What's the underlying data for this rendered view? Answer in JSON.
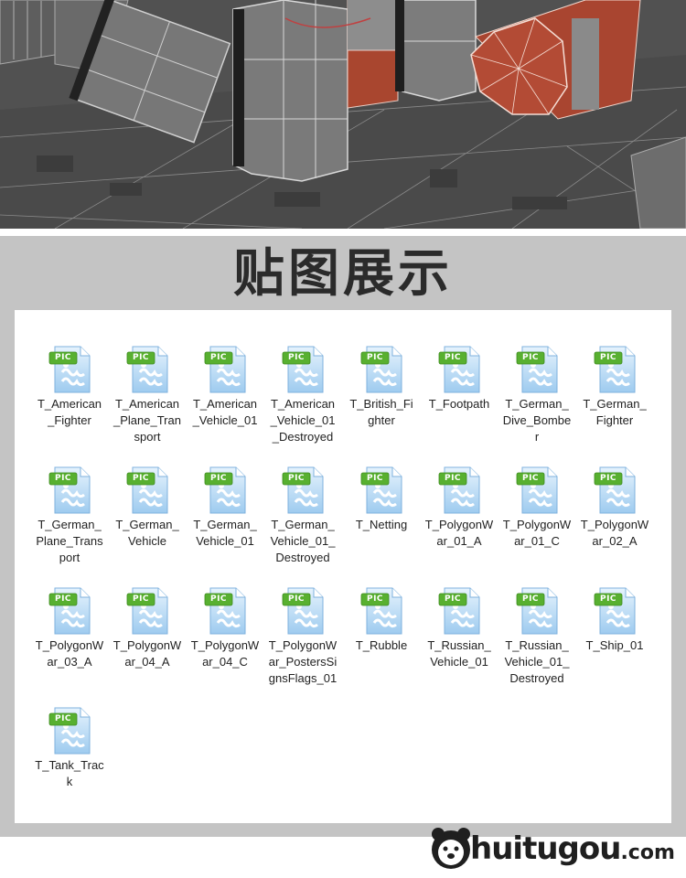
{
  "section_title": "贴图展示",
  "badge": "PIC",
  "files": [
    "T_American_Fighter",
    "T_American_Plane_Transport",
    "T_American_Vehicle_01",
    "T_American_Vehicle_01_Destroyed",
    "T_British_Fighter",
    "T_Footpath",
    "T_German_Dive_Bomber",
    "T_German_Fighter",
    "T_German_Plane_Transport",
    "T_German_Vehicle",
    "T_German_Vehicle_01",
    "T_German_Vehicle_01_Destroyed",
    "T_Netting",
    "T_PolygonWar_01_A",
    "T_PolygonWar_01_C",
    "T_PolygonWar_02_A",
    "T_PolygonWar_03_A",
    "T_PolygonWar_04_A",
    "T_PolygonWar_04_C",
    "T_PolygonWar_PostersSignsFlags_01",
    "T_Rubble",
    "T_Russian_Vehicle_01",
    "T_Russian_Vehicle_01_Destroyed",
    "T_Ship_01",
    "T_Tank_Track"
  ],
  "logo": {
    "main": "huitugou",
    "suffix": ".com"
  },
  "colors": {
    "badge_green": "#58b030",
    "icon_blue": "#bcdcf4",
    "render_red": "#b24a36"
  }
}
